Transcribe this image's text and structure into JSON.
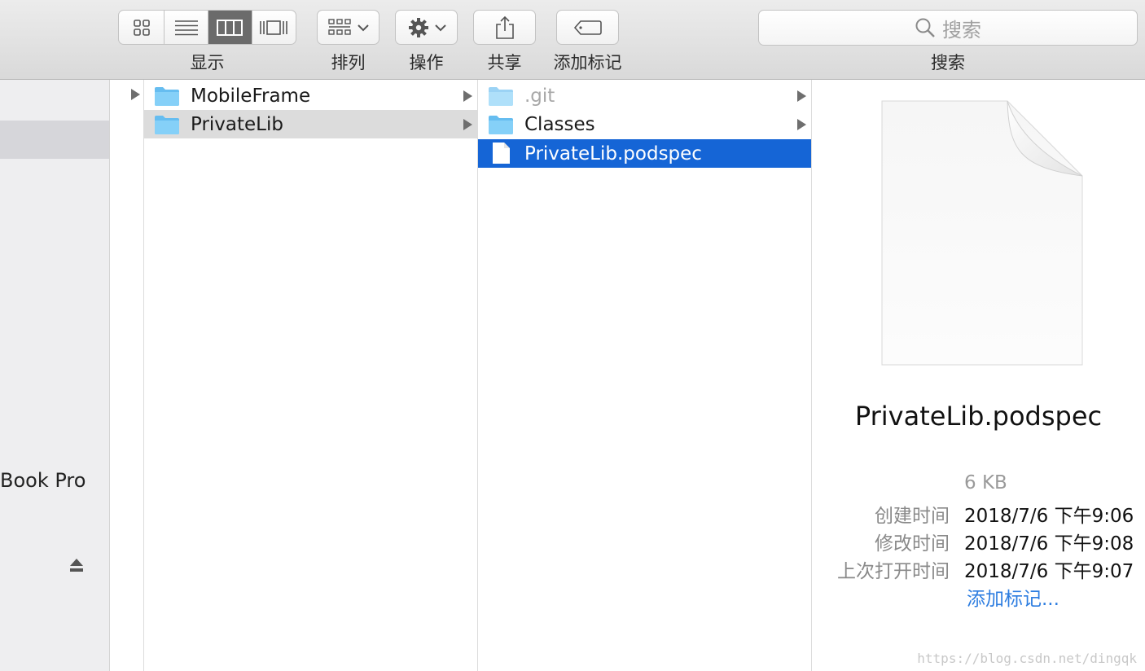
{
  "toolbar": {
    "view_label": "显示",
    "arrange_label": "排列",
    "action_label": "操作",
    "share_label": "共享",
    "tags_label": "添加标记",
    "search_label": "搜索",
    "search_placeholder": "搜索"
  },
  "sidebar": {
    "device_name": "Book Pro"
  },
  "columns": {
    "col1": [
      {
        "name": "MobileFrame",
        "type": "folder"
      },
      {
        "name": "PrivateLib",
        "type": "folder"
      }
    ],
    "col2": [
      {
        "name": ".git",
        "type": "folder"
      },
      {
        "name": "Classes",
        "type": "folder"
      },
      {
        "name": "PrivateLib.podspec",
        "type": "file"
      }
    ]
  },
  "preview": {
    "file_name": "PrivateLib.podspec",
    "size": "6 KB",
    "created_label": "创建时间",
    "created": "2018/7/6 下午9:06",
    "modified_label": "修改时间",
    "modified": "2018/7/6 下午9:08",
    "opened_label": "上次打开时间",
    "opened": "2018/7/6 下午9:07",
    "add_tags": "添加标记..."
  },
  "watermark": "https://blog.csdn.net/dingqk",
  "colors": {
    "selection_blue": "#1565d6",
    "link_blue": "#2d7de0",
    "folder_blue": "#74c6f4"
  }
}
